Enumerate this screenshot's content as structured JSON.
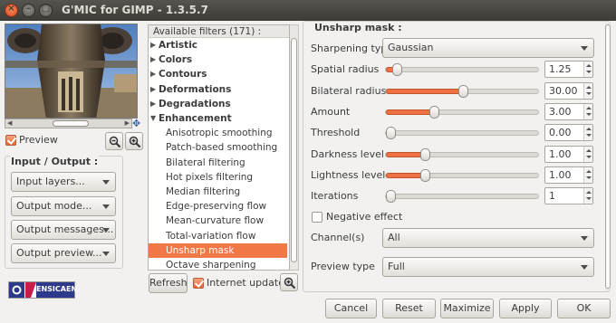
{
  "window": {
    "title": "G'MIC for GIMP - 1.3.5.7"
  },
  "preview": {
    "checkbox_label": "Preview",
    "checked": true
  },
  "io": {
    "title": "Input / Output :",
    "input_layers": "Input layers...",
    "output_mode": "Output mode...",
    "output_messages": "Output messages...",
    "output_preview": "Output preview..."
  },
  "logo": {
    "text": "ENSICAEN"
  },
  "filters": {
    "header": "Available filters (171) :",
    "items": [
      {
        "label": "Artistic",
        "kind": "cat",
        "expanded": false
      },
      {
        "label": "Colors",
        "kind": "cat",
        "expanded": false
      },
      {
        "label": "Contours",
        "kind": "cat",
        "expanded": false
      },
      {
        "label": "Deformations",
        "kind": "cat",
        "expanded": false
      },
      {
        "label": "Degradations",
        "kind": "cat",
        "expanded": false
      },
      {
        "label": "Enhancement",
        "kind": "cat",
        "expanded": true
      },
      {
        "label": "Anisotropic smoothing",
        "kind": "sub"
      },
      {
        "label": "Patch-based smoothing",
        "kind": "sub"
      },
      {
        "label": "Bilateral filtering",
        "kind": "sub"
      },
      {
        "label": "Hot pixels filtering",
        "kind": "sub"
      },
      {
        "label": "Median filtering",
        "kind": "sub"
      },
      {
        "label": "Edge-preserving flow",
        "kind": "sub"
      },
      {
        "label": "Mean-curvature flow",
        "kind": "sub"
      },
      {
        "label": "Total-variation flow",
        "kind": "sub"
      },
      {
        "label": "Unsharp mask",
        "kind": "sub",
        "selected": true
      },
      {
        "label": "Octave sharpening",
        "kind": "sub"
      }
    ],
    "refresh_label": "Refresh",
    "internet_updates_label": "Internet updates",
    "internet_updates_checked": true
  },
  "filter_panel": {
    "title": "Unsharp mask :",
    "sharpening_type": {
      "label": "Sharpening type",
      "value": "Gaussian"
    },
    "params": [
      {
        "label": "Spatial radius",
        "value": "1.25",
        "level": 0.07
      },
      {
        "label": "Bilateral radius",
        "value": "30.00",
        "level": 0.5
      },
      {
        "label": "Amount",
        "value": "3.00",
        "level": 0.31
      },
      {
        "label": "Threshold",
        "value": "0.00",
        "level": 0.0
      },
      {
        "label": "Darkness level",
        "value": "1.00",
        "level": 0.25
      },
      {
        "label": "Lightness level",
        "value": "1.00",
        "level": 0.25
      },
      {
        "label": "Iterations",
        "value": "1",
        "level": 0.0
      }
    ],
    "negative_effect": {
      "label": "Negative effect",
      "checked": false
    },
    "channels": {
      "label": "Channel(s)",
      "value": "All"
    },
    "preview_type": {
      "label": "Preview type",
      "value": "Full"
    }
  },
  "buttons": {
    "cancel": "Cancel",
    "reset": "Reset",
    "maximize": "Maximize",
    "apply": "Apply",
    "ok": "OK"
  },
  "colors": {
    "accent": "#f07746",
    "titlebar": "#3c3b37"
  }
}
